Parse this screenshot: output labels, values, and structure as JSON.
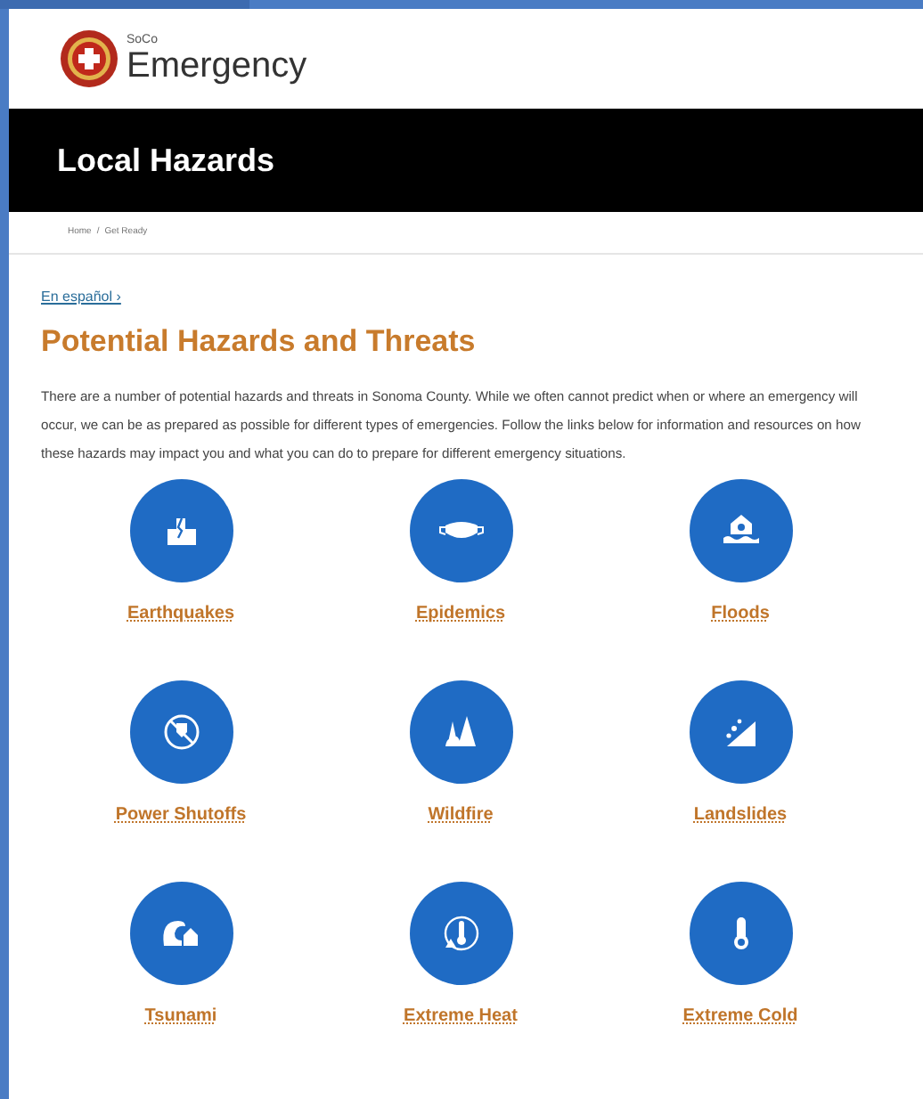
{
  "logo": {
    "small": "SoCo",
    "name": "Emergency"
  },
  "banner": {
    "title": "Local Hazards"
  },
  "breadcrumb": {
    "items": [
      "Home",
      "Get Ready"
    ],
    "separator": "/"
  },
  "language_link": "En español ›",
  "heading": "Potential Hazards and Threats",
  "intro": "There are a number of potential hazards and threats in Sonoma County. While we often cannot predict when or where an emergency will occur, we can be as prepared as possible for different types of emergencies. Follow the links below for information and resources on how these hazards may impact you and what you can do to prepare for different emergency situations.",
  "hazards": [
    {
      "label": "Earthquakes"
    },
    {
      "label": "Epidemics"
    },
    {
      "label": "Floods"
    },
    {
      "label": "Power Shutoffs"
    },
    {
      "label": "Wildfire"
    },
    {
      "label": "Landslides"
    },
    {
      "label": "Tsunami"
    },
    {
      "label": "Extreme Heat"
    },
    {
      "label": "Extreme Cold"
    }
  ]
}
